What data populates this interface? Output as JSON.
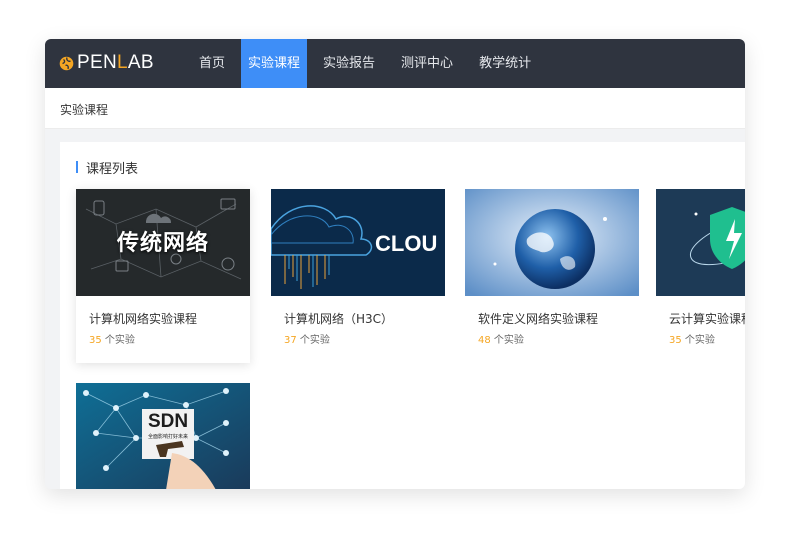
{
  "app": {
    "logo_left": "PEN",
    "logo_mid": "L",
    "logo_right": "AB"
  },
  "nav": {
    "items": [
      {
        "label": "首页",
        "active": false
      },
      {
        "label": "实验课程",
        "active": true
      },
      {
        "label": "实验报告",
        "active": false
      },
      {
        "label": "测评中心",
        "active": false
      },
      {
        "label": "教学统计",
        "active": false
      }
    ]
  },
  "breadcrumb": "实验课程",
  "section_title": "课程列表",
  "courses": [
    {
      "title": "计算机网络实验课程",
      "count": "35",
      "unit": " 个实验",
      "thumb_text": "传统网络"
    },
    {
      "title": "计算机网络（H3C）",
      "count": "37",
      "unit": " 个实验",
      "thumb_text": "CLOU"
    },
    {
      "title": "软件定义网络实验课程",
      "count": "48",
      "unit": " 个实验"
    },
    {
      "title": "云计算实验课程",
      "count": "35",
      "unit": " 个实验"
    },
    {
      "thumb_text": "SDN",
      "thumb_subtext": "全面影响打好未来"
    }
  ],
  "colors": {
    "topbar": "#2f343f",
    "accent": "#3e8ef7",
    "count": "#f5a623"
  }
}
